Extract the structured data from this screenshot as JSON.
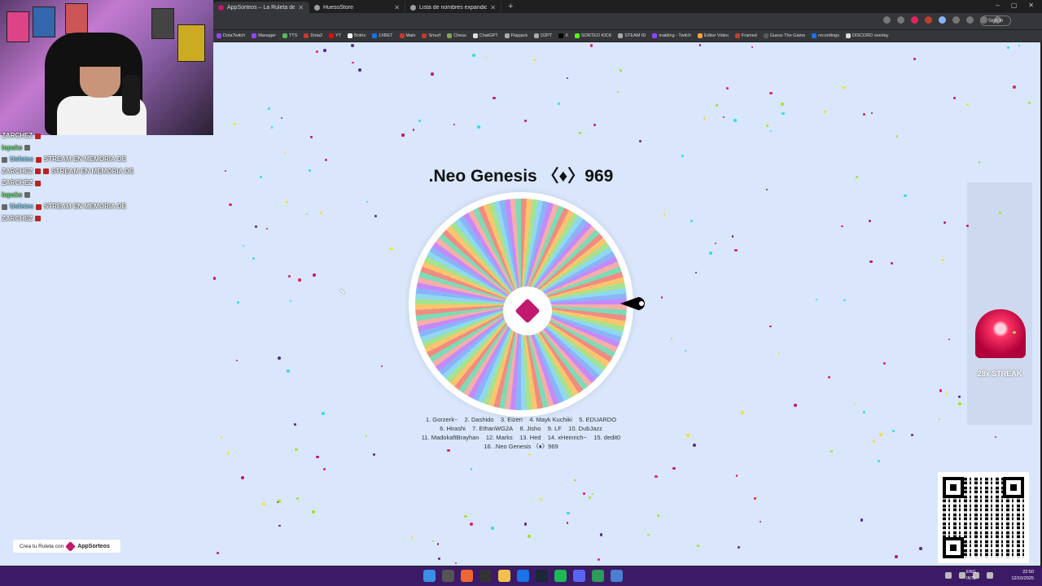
{
  "tabs": [
    {
      "label": "AppSorteos – La Ruleta de la...",
      "active": true,
      "color": "#c2186f"
    },
    {
      "label": "HuesoStore",
      "active": false,
      "color": "#9aa0a6"
    },
    {
      "label": "Lista de nombres expandida",
      "active": false,
      "color": "#9aa0a6"
    }
  ],
  "toolbar": {
    "signin": "Sign in"
  },
  "bookmarks": [
    {
      "label": "DotaTwitch",
      "color": "#9146ff"
    },
    {
      "label": "Manager",
      "color": "#9146ff"
    },
    {
      "label": "TTS",
      "color": "#5cb85c"
    },
    {
      "label": "Dota2",
      "color": "#c23c2a"
    },
    {
      "label": "YT",
      "color": "#ff0000"
    },
    {
      "label": "Botrix",
      "color": "#ffffff"
    },
    {
      "label": "1XBET",
      "color": "#1a73e8"
    },
    {
      "label": "Main",
      "color": "#c23c2a"
    },
    {
      "label": "Smurf",
      "color": "#c23c2a"
    },
    {
      "label": "Chess",
      "color": "#7fa650"
    },
    {
      "label": "ChatGPT",
      "color": "#dddddd"
    },
    {
      "label": "Flapjack",
      "color": "#aaaaaa"
    },
    {
      "label": "D2PT",
      "color": "#aaaaaa"
    },
    {
      "label": "X",
      "color": "#000000"
    },
    {
      "label": "SORTEO KICK",
      "color": "#53fc18"
    },
    {
      "label": "STEAM ID",
      "color": "#aaaaaa"
    },
    {
      "label": "malding - Twitch",
      "color": "#9146ff"
    },
    {
      "label": "Editor Video",
      "color": "#f2a33a"
    },
    {
      "label": "Framed",
      "color": "#c23c2a"
    },
    {
      "label": "Guess The Game",
      "color": "#5a5a5a"
    },
    {
      "label": "recordings",
      "color": "#1a73e8"
    },
    {
      "label": "DISCORD overlay",
      "color": "#dddddd"
    }
  ],
  "chat": [
    {
      "text": "ZARCHEZ",
      "user": "",
      "badge": true
    },
    {
      "text": "",
      "user": "lopake",
      "badge": false
    },
    {
      "text": "STREAM EN MEMORIA DE",
      "user": "Usfetes",
      "badge": true
    },
    {
      "text": "ZARCHEZ",
      "user": "",
      "badge": true,
      "extra": "STREAM EN MEMORIA DE"
    },
    {
      "text": "ZARCHEZ",
      "user": "",
      "badge": true
    },
    {
      "text": "",
      "user": "lopake",
      "badge": false
    },
    {
      "text": "STREAM EN MEMORIA DE",
      "user": "Usfetes",
      "badge": true
    },
    {
      "text": "ZARCHEZ",
      "user": "",
      "badge": true
    }
  ],
  "wheel": {
    "title": ".Neo Genesis 〈♦〉969",
    "names": [
      "1. Gorzerk~",
      "2. Dashido",
      "3. Eizen",
      "4. Mayk Kuchiki",
      "5. EDUARDO",
      "6. Hirashi",
      "7. EthanWG2A",
      "8. Jisho",
      "9. LF",
      "10. DubJazz",
      "11. MadokaftBrayhan",
      "12. Marks",
      "13. Hed",
      "14. xHeinrich~",
      "15. dedit0",
      "16. .Neo Genesis 〈♦〉969"
    ]
  },
  "streak": {
    "label": "28x STREAK"
  },
  "brand": {
    "prefix": "Crea tu Ruleta con",
    "name": "AppSorteos"
  },
  "taskbar": {
    "lang_1": "ENG",
    "lang_2": "INTL",
    "time": "22:50",
    "date": "12/10/2025"
  }
}
